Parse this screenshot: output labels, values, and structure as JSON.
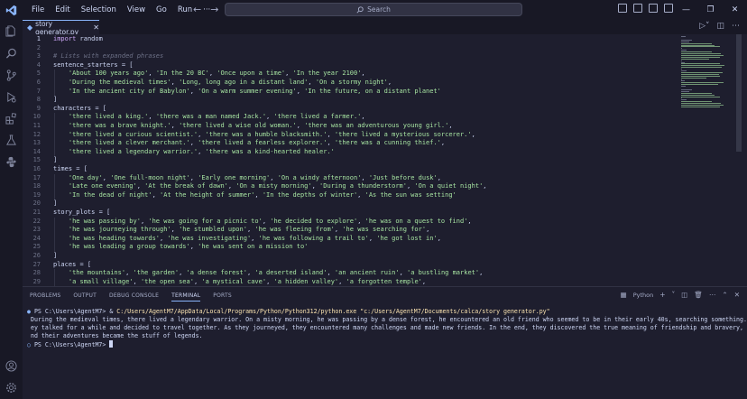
{
  "titlebar": {
    "menu": [
      "File",
      "Edit",
      "Selection",
      "View",
      "Go",
      "Run",
      "···"
    ],
    "search_placeholder": "Search",
    "logo": "vscode-logo-icon",
    "icons": [
      "back-arrow-icon",
      "forward-arrow-icon",
      "toggle-primary-sidebar-icon",
      "toggle-panel-icon",
      "toggle-secondary-sidebar-icon",
      "customize-layout-icon"
    ],
    "window_controls": [
      "minimize-icon",
      "restore-icon",
      "close-icon"
    ]
  },
  "activitybar": {
    "icons": [
      "explorer-icon",
      "search-icon",
      "source-control-icon",
      "run-debug-icon",
      "extensions-icon",
      "testing-icon",
      "python-icon",
      "account-icon",
      "manage-gear-icon"
    ]
  },
  "editor_tab": {
    "label": "story generator.py",
    "close": "✕",
    "icon": "python-file-icon"
  },
  "editor_actions": [
    "run-python-file-icon",
    "split-editor-icon",
    "more-actions-icon"
  ],
  "code": [
    {
      "n": "1",
      "parts": [
        [
          "kw",
          "import"
        ],
        [
          "txt",
          " random"
        ]
      ]
    },
    {
      "n": "2",
      "parts": []
    },
    {
      "n": "3",
      "parts": [
        [
          "cm",
          "# Lists with expanded phrases"
        ]
      ]
    },
    {
      "n": "4",
      "parts": [
        [
          "txt",
          "sentence_starters = ["
        ]
      ]
    },
    {
      "n": "5",
      "parts": [
        [
          "txt",
          "    "
        ],
        [
          "str",
          "'About 100 years ago'"
        ],
        [
          "txt",
          ", "
        ],
        [
          "str",
          "'In the 20 BC'"
        ],
        [
          "txt",
          ", "
        ],
        [
          "str",
          "'Once upon a time'"
        ],
        [
          "txt",
          ", "
        ],
        [
          "str",
          "'In the year 2100'"
        ],
        [
          "txt",
          ","
        ]
      ]
    },
    {
      "n": "6",
      "parts": [
        [
          "txt",
          "    "
        ],
        [
          "str",
          "'During the medieval times'"
        ],
        [
          "txt",
          ", "
        ],
        [
          "str",
          "'Long, long ago in a distant land'"
        ],
        [
          "txt",
          ", "
        ],
        [
          "str",
          "'On a stormy night'"
        ],
        [
          "txt",
          ","
        ]
      ]
    },
    {
      "n": "7",
      "parts": [
        [
          "txt",
          "    "
        ],
        [
          "str",
          "'In the ancient city of Babylon'"
        ],
        [
          "txt",
          ", "
        ],
        [
          "str",
          "'On a warm summer evening'"
        ],
        [
          "txt",
          ", "
        ],
        [
          "str",
          "'In the future, on a distant planet'"
        ]
      ]
    },
    {
      "n": "8",
      "parts": [
        [
          "txt",
          "]"
        ]
      ]
    },
    {
      "n": "9",
      "parts": [
        [
          "txt",
          "characters = ["
        ]
      ]
    },
    {
      "n": "10",
      "parts": [
        [
          "txt",
          "    "
        ],
        [
          "str",
          "'there lived a king.'"
        ],
        [
          "txt",
          ", "
        ],
        [
          "str",
          "'there was a man named Jack.'"
        ],
        [
          "txt",
          ", "
        ],
        [
          "str",
          "'there lived a farmer.'"
        ],
        [
          "txt",
          ","
        ]
      ]
    },
    {
      "n": "11",
      "parts": [
        [
          "txt",
          "    "
        ],
        [
          "str",
          "'there was a brave knight.'"
        ],
        [
          "txt",
          ", "
        ],
        [
          "str",
          "'there lived a wise old woman.'"
        ],
        [
          "txt",
          ", "
        ],
        [
          "str",
          "'there was an adventurous young girl.'"
        ],
        [
          "txt",
          ","
        ]
      ]
    },
    {
      "n": "12",
      "parts": [
        [
          "txt",
          "    "
        ],
        [
          "str",
          "'there lived a curious scientist.'"
        ],
        [
          "txt",
          ", "
        ],
        [
          "str",
          "'there was a humble blacksmith.'"
        ],
        [
          "txt",
          ", "
        ],
        [
          "str",
          "'there lived a mysterious sorcerer.'"
        ],
        [
          "txt",
          ","
        ]
      ]
    },
    {
      "n": "13",
      "parts": [
        [
          "txt",
          "    "
        ],
        [
          "str",
          "'there lived a clever merchant.'"
        ],
        [
          "txt",
          ", "
        ],
        [
          "str",
          "'there lived a fearless explorer.'"
        ],
        [
          "txt",
          ", "
        ],
        [
          "str",
          "'there was a cunning thief.'"
        ],
        [
          "txt",
          ","
        ]
      ]
    },
    {
      "n": "14",
      "parts": [
        [
          "txt",
          "    "
        ],
        [
          "str",
          "'there lived a legendary warrior.'"
        ],
        [
          "txt",
          ", "
        ],
        [
          "str",
          "'there was a kind-hearted healer.'"
        ]
      ]
    },
    {
      "n": "15",
      "parts": [
        [
          "txt",
          "]"
        ]
      ]
    },
    {
      "n": "16",
      "parts": [
        [
          "txt",
          "times = ["
        ]
      ]
    },
    {
      "n": "17",
      "parts": [
        [
          "txt",
          "    "
        ],
        [
          "str",
          "'One day'"
        ],
        [
          "txt",
          ", "
        ],
        [
          "str",
          "'One full-moon night'"
        ],
        [
          "txt",
          ", "
        ],
        [
          "str",
          "'Early one morning'"
        ],
        [
          "txt",
          ", "
        ],
        [
          "str",
          "'On a windy afternoon'"
        ],
        [
          "txt",
          ", "
        ],
        [
          "str",
          "'Just before dusk'"
        ],
        [
          "txt",
          ","
        ]
      ]
    },
    {
      "n": "18",
      "parts": [
        [
          "txt",
          "    "
        ],
        [
          "str",
          "'Late one evening'"
        ],
        [
          "txt",
          ", "
        ],
        [
          "str",
          "'At the break of dawn'"
        ],
        [
          "txt",
          ", "
        ],
        [
          "str",
          "'On a misty morning'"
        ],
        [
          "txt",
          ", "
        ],
        [
          "str",
          "'During a thunderstorm'"
        ],
        [
          "txt",
          ", "
        ],
        [
          "str",
          "'On a quiet night'"
        ],
        [
          "txt",
          ","
        ]
      ]
    },
    {
      "n": "19",
      "parts": [
        [
          "txt",
          "    "
        ],
        [
          "str",
          "'In the dead of night'"
        ],
        [
          "txt",
          ", "
        ],
        [
          "str",
          "'At the height of summer'"
        ],
        [
          "txt",
          ", "
        ],
        [
          "str",
          "'In the depths of winter'"
        ],
        [
          "txt",
          ", "
        ],
        [
          "str",
          "'As the sun was setting'"
        ]
      ]
    },
    {
      "n": "20",
      "parts": [
        [
          "txt",
          "]"
        ]
      ]
    },
    {
      "n": "21",
      "parts": [
        [
          "txt",
          "story_plots = ["
        ]
      ]
    },
    {
      "n": "22",
      "parts": [
        [
          "txt",
          "    "
        ],
        [
          "str",
          "'he was passing by'"
        ],
        [
          "txt",
          ", "
        ],
        [
          "str",
          "'he was going for a picnic to'"
        ],
        [
          "txt",
          ", "
        ],
        [
          "str",
          "'he decided to explore'"
        ],
        [
          "txt",
          ", "
        ],
        [
          "str",
          "'he was on a quest to find'"
        ],
        [
          "txt",
          ","
        ]
      ]
    },
    {
      "n": "23",
      "parts": [
        [
          "txt",
          "    "
        ],
        [
          "str",
          "'he was journeying through'"
        ],
        [
          "txt",
          ", "
        ],
        [
          "str",
          "'he stumbled upon'"
        ],
        [
          "txt",
          ", "
        ],
        [
          "str",
          "'he was fleeing from'"
        ],
        [
          "txt",
          ", "
        ],
        [
          "str",
          "'he was searching for'"
        ],
        [
          "txt",
          ","
        ]
      ]
    },
    {
      "n": "24",
      "parts": [
        [
          "txt",
          "    "
        ],
        [
          "str",
          "'he was heading towards'"
        ],
        [
          "txt",
          ", "
        ],
        [
          "str",
          "'he was investigating'"
        ],
        [
          "txt",
          ", "
        ],
        [
          "str",
          "'he was following a trail to'"
        ],
        [
          "txt",
          ", "
        ],
        [
          "str",
          "'he got lost in'"
        ],
        [
          "txt",
          ","
        ]
      ]
    },
    {
      "n": "25",
      "parts": [
        [
          "txt",
          "    "
        ],
        [
          "str",
          "'he was leading a group towards'"
        ],
        [
          "txt",
          ", "
        ],
        [
          "str",
          "'he was sent on a mission to'"
        ]
      ]
    },
    {
      "n": "26",
      "parts": [
        [
          "txt",
          "]"
        ]
      ]
    },
    {
      "n": "27",
      "parts": [
        [
          "txt",
          "places = ["
        ]
      ]
    },
    {
      "n": "28",
      "parts": [
        [
          "txt",
          "    "
        ],
        [
          "str",
          "'the mountains'"
        ],
        [
          "txt",
          ", "
        ],
        [
          "str",
          "'the garden'"
        ],
        [
          "txt",
          ", "
        ],
        [
          "str",
          "'a dense forest'"
        ],
        [
          "txt",
          ", "
        ],
        [
          "str",
          "'a deserted island'"
        ],
        [
          "txt",
          ", "
        ],
        [
          "str",
          "'an ancient ruin'"
        ],
        [
          "txt",
          ", "
        ],
        [
          "str",
          "'a bustling market'"
        ],
        [
          "txt",
          ","
        ]
      ]
    },
    {
      "n": "29",
      "parts": [
        [
          "txt",
          "    "
        ],
        [
          "str",
          "'a small village'"
        ],
        [
          "txt",
          ", "
        ],
        [
          "str",
          "'the open sea'"
        ],
        [
          "txt",
          ", "
        ],
        [
          "str",
          "'a mystical cave'"
        ],
        [
          "txt",
          ", "
        ],
        [
          "str",
          "'a hidden valley'"
        ],
        [
          "txt",
          ", "
        ],
        [
          "str",
          "'a forgotten temple'"
        ],
        [
          "txt",
          ","
        ]
      ]
    }
  ],
  "panel": {
    "tabs": [
      "PROBLEMS",
      "OUTPUT",
      "DEBUG CONSOLE",
      "TERMINAL",
      "PORTS"
    ],
    "active_tab": "TERMINAL",
    "terminal_name": "Python",
    "actions": [
      "python-terminal-icon",
      "add-terminal-icon",
      "terminal-dropdown-icon",
      "split-terminal-icon",
      "kill-terminal-icon",
      "more-actions-icon",
      "maximize-panel-icon",
      "close-panel-icon"
    ]
  },
  "terminal": {
    "cmd_prompt": "PS C:\\Users\\AgentM7> & ",
    "cmd_exe": "C:/Users/AgentM7/AppData/Local/Programs/Python/Python312/python.exe",
    "cmd_arg": " \"c:/Users/AgentM7/Documents/calca/story generator.py\"",
    "output": [
      "During the medieval times, there lived a legendary warrior. On a misty morning, he was passing by a dense forest, he encountered an old friend who seemed to be in their early 40s, searching something. Th",
      "ey talked for a while and decided to travel together. As they journeyed, they encountered many challenges and made new friends. In the end, they discovered the true meaning of friendship and bravery, a",
      "nd their adventures became the stuff of legends."
    ],
    "final_prompt": "PS C:\\Users\\AgentM7>"
  },
  "colors": {
    "background": "#1e1e2e",
    "chrome": "#181825",
    "accent": "#89b4fa",
    "string": "#a6e3a1",
    "keyword": "#cba6f7",
    "path": "#f9e2af"
  }
}
